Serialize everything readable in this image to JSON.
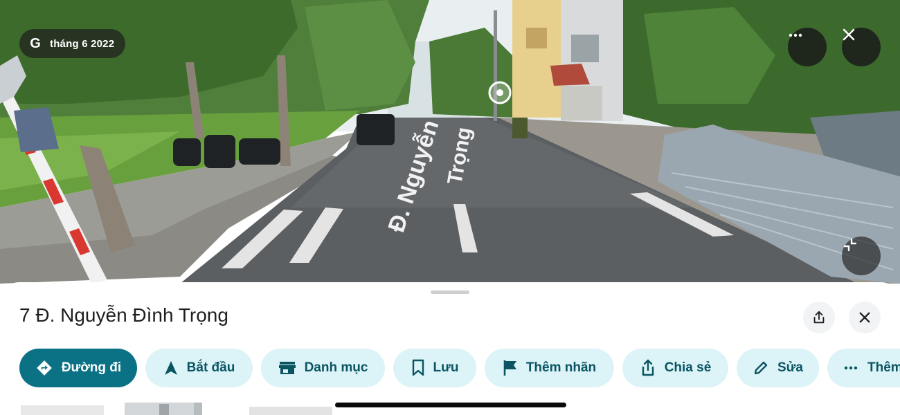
{
  "street_view": {
    "date_label": "tháng 6 2022",
    "google_mark": "G",
    "road_marking_line1": "Đ. Nguyễn",
    "road_marking_line2": "Trọng",
    "icons": [
      "more-horizontal-icon",
      "close-icon",
      "collapse-icon",
      "navigation-target-icon"
    ]
  },
  "sheet": {
    "title": "7 Đ. Nguyễn Đình Trọng",
    "share_icon": "share-icon",
    "close_icon": "close-icon"
  },
  "actions": [
    {
      "label": "Đường đi",
      "icon": "directions-icon",
      "primary": true
    },
    {
      "label": "Bắt đầu",
      "icon": "navigation-arrow-icon"
    },
    {
      "label": "Danh mục",
      "icon": "store-icon"
    },
    {
      "label": "Lưu",
      "icon": "bookmark-icon"
    },
    {
      "label": "Thêm nhãn",
      "icon": "flag-icon"
    },
    {
      "label": "Chia sẻ",
      "icon": "share-icon"
    },
    {
      "label": "Sửa",
      "icon": "pencil-icon"
    },
    {
      "label": "Thêm",
      "icon": "more-horizontal-icon"
    }
  ],
  "colors": {
    "accent": "#0b7285",
    "chip_bg": "#dcf3f7",
    "chip_text": "#0b5563"
  }
}
